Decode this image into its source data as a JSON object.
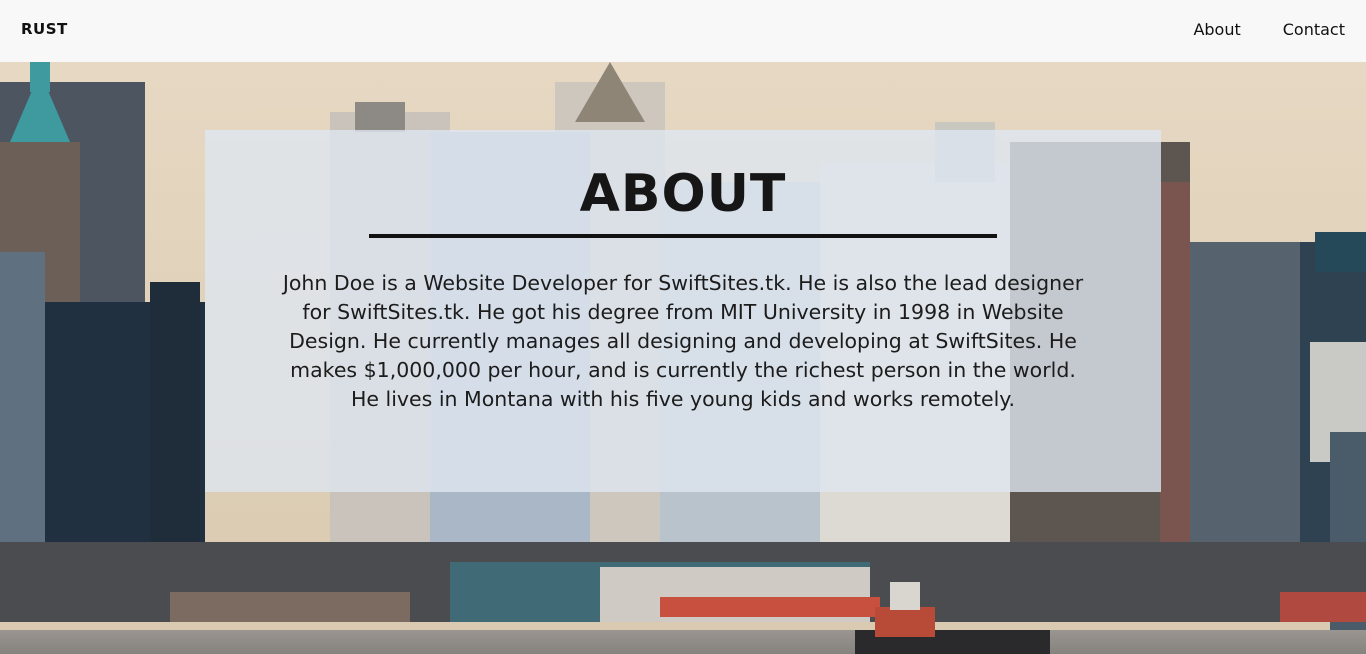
{
  "nav": {
    "brand": "RUST",
    "links": [
      "About",
      "Contact"
    ]
  },
  "about": {
    "heading": "ABOUT",
    "body": "John Doe is a Website Developer for SwiftSites.tk. He is also the lead designer for SwiftSites.tk. He got his degree from MIT University in 1998 in Website Design. He currently manages all designing and developing at SwiftSites. He makes $1,000,000 per hour, and is currently the richest person in the world. He lives in Montana with his five young kids and works remotely."
  },
  "colors": {
    "navbar_bg": "#f8f8f8",
    "panel_bg": "rgba(222,230,240,0.80)",
    "text": "#161616"
  }
}
